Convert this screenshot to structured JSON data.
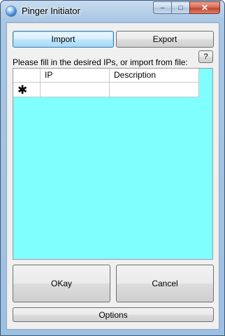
{
  "window": {
    "title": "Pinger Initiator",
    "close_glyph": "✕",
    "minimize_glyph": "–",
    "maximize_glyph": "□"
  },
  "toolbar": {
    "import_label": "Import",
    "export_label": "Export",
    "help_label": "?"
  },
  "hint": "Please fill in the desired IPs, or import from file:",
  "grid": {
    "columns": [
      "IP",
      "Description"
    ],
    "new_row_marker": "✱",
    "background": "#80ffff"
  },
  "actions": {
    "ok_label": "OKay",
    "cancel_label": "Cancel",
    "options_label": "Options"
  }
}
